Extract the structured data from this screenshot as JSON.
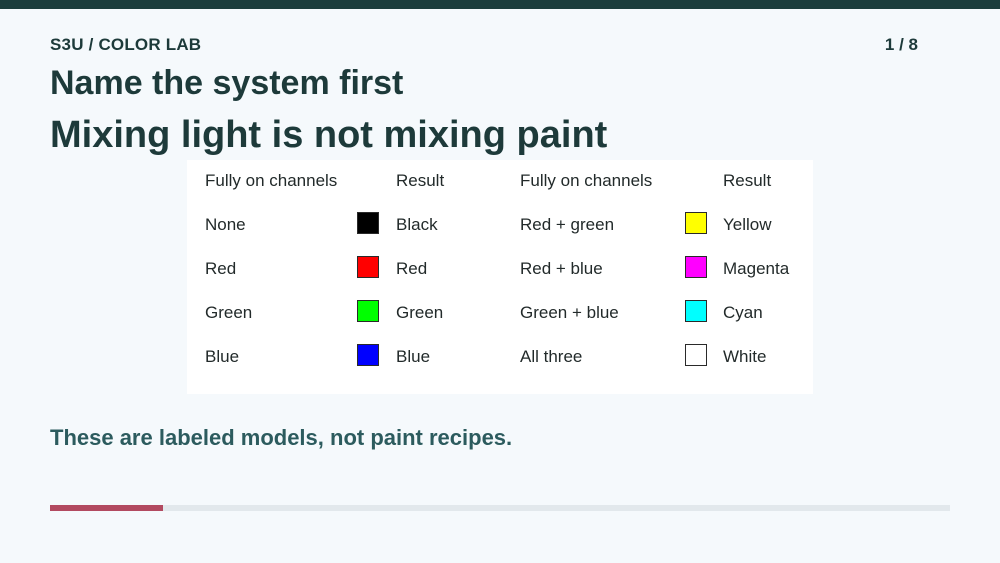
{
  "header": {
    "brand": "S3U / COLOR LAB",
    "page_count": "1 / 8",
    "progress": {
      "current": 1,
      "total": 8
    }
  },
  "slide": {
    "heading": "Name the system first",
    "title": "Mixing light is not mixing paint",
    "caption": "These are labeled models, not paint recipes."
  },
  "table": {
    "headers": [
      "Fully on channels",
      "Result",
      "Fully on channels",
      "Result"
    ],
    "left_rows": [
      {
        "channels": "None",
        "result": "Black",
        "color": "#000000"
      },
      {
        "channels": "Red",
        "result": "Red",
        "color": "#ff0000"
      },
      {
        "channels": "Green",
        "result": "Green",
        "color": "#00ff00"
      },
      {
        "channels": "Blue",
        "result": "Blue",
        "color": "#0000ff"
      }
    ],
    "right_rows": [
      {
        "channels": "Red + green",
        "result": "Yellow",
        "color": "#ffff00"
      },
      {
        "channels": "Red + blue",
        "result": "Magenta",
        "color": "#ff00ff"
      },
      {
        "channels": "Green + blue",
        "result": "Cyan",
        "color": "#00ffff"
      },
      {
        "channels": "All three",
        "result": "White",
        "color": "#ffffff"
      }
    ]
  },
  "colors": {
    "top_bar": "#1c3d3d",
    "progress_fill": "#b24a60",
    "progress_track": "#e2e8ec"
  }
}
